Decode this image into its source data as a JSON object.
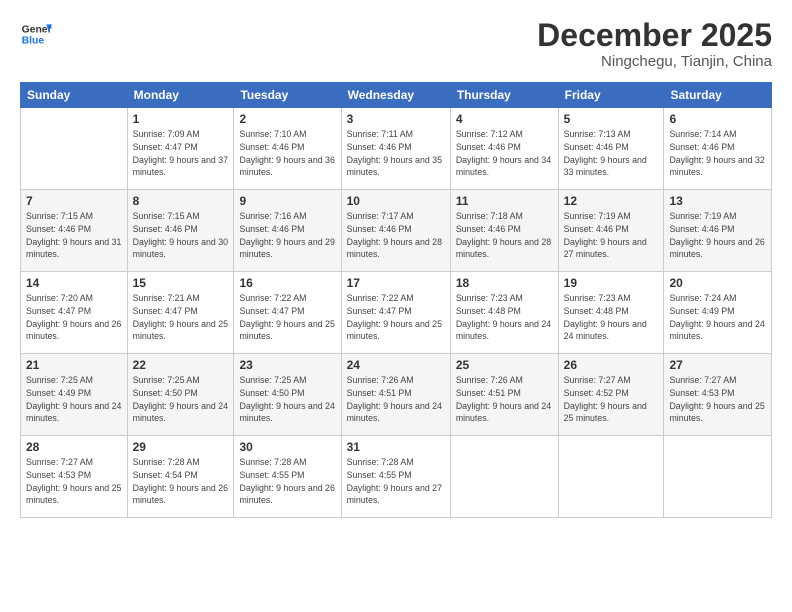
{
  "logo": {
    "line1": "General",
    "line2": "Blue"
  },
  "title": "December 2025",
  "location": "Ningchegu, Tianjin, China",
  "weekdays": [
    "Sunday",
    "Monday",
    "Tuesday",
    "Wednesday",
    "Thursday",
    "Friday",
    "Saturday"
  ],
  "weeks": [
    [
      {
        "day": "",
        "sunrise": "",
        "sunset": "",
        "daylight": ""
      },
      {
        "day": "1",
        "sunrise": "Sunrise: 7:09 AM",
        "sunset": "Sunset: 4:47 PM",
        "daylight": "Daylight: 9 hours and 37 minutes."
      },
      {
        "day": "2",
        "sunrise": "Sunrise: 7:10 AM",
        "sunset": "Sunset: 4:46 PM",
        "daylight": "Daylight: 9 hours and 36 minutes."
      },
      {
        "day": "3",
        "sunrise": "Sunrise: 7:11 AM",
        "sunset": "Sunset: 4:46 PM",
        "daylight": "Daylight: 9 hours and 35 minutes."
      },
      {
        "day": "4",
        "sunrise": "Sunrise: 7:12 AM",
        "sunset": "Sunset: 4:46 PM",
        "daylight": "Daylight: 9 hours and 34 minutes."
      },
      {
        "day": "5",
        "sunrise": "Sunrise: 7:13 AM",
        "sunset": "Sunset: 4:46 PM",
        "daylight": "Daylight: 9 hours and 33 minutes."
      },
      {
        "day": "6",
        "sunrise": "Sunrise: 7:14 AM",
        "sunset": "Sunset: 4:46 PM",
        "daylight": "Daylight: 9 hours and 32 minutes."
      }
    ],
    [
      {
        "day": "7",
        "sunrise": "Sunrise: 7:15 AM",
        "sunset": "Sunset: 4:46 PM",
        "daylight": "Daylight: 9 hours and 31 minutes."
      },
      {
        "day": "8",
        "sunrise": "Sunrise: 7:15 AM",
        "sunset": "Sunset: 4:46 PM",
        "daylight": "Daylight: 9 hours and 30 minutes."
      },
      {
        "day": "9",
        "sunrise": "Sunrise: 7:16 AM",
        "sunset": "Sunset: 4:46 PM",
        "daylight": "Daylight: 9 hours and 29 minutes."
      },
      {
        "day": "10",
        "sunrise": "Sunrise: 7:17 AM",
        "sunset": "Sunset: 4:46 PM",
        "daylight": "Daylight: 9 hours and 28 minutes."
      },
      {
        "day": "11",
        "sunrise": "Sunrise: 7:18 AM",
        "sunset": "Sunset: 4:46 PM",
        "daylight": "Daylight: 9 hours and 28 minutes."
      },
      {
        "day": "12",
        "sunrise": "Sunrise: 7:19 AM",
        "sunset": "Sunset: 4:46 PM",
        "daylight": "Daylight: 9 hours and 27 minutes."
      },
      {
        "day": "13",
        "sunrise": "Sunrise: 7:19 AM",
        "sunset": "Sunset: 4:46 PM",
        "daylight": "Daylight: 9 hours and 26 minutes."
      }
    ],
    [
      {
        "day": "14",
        "sunrise": "Sunrise: 7:20 AM",
        "sunset": "Sunset: 4:47 PM",
        "daylight": "Daylight: 9 hours and 26 minutes."
      },
      {
        "day": "15",
        "sunrise": "Sunrise: 7:21 AM",
        "sunset": "Sunset: 4:47 PM",
        "daylight": "Daylight: 9 hours and 25 minutes."
      },
      {
        "day": "16",
        "sunrise": "Sunrise: 7:22 AM",
        "sunset": "Sunset: 4:47 PM",
        "daylight": "Daylight: 9 hours and 25 minutes."
      },
      {
        "day": "17",
        "sunrise": "Sunrise: 7:22 AM",
        "sunset": "Sunset: 4:47 PM",
        "daylight": "Daylight: 9 hours and 25 minutes."
      },
      {
        "day": "18",
        "sunrise": "Sunrise: 7:23 AM",
        "sunset": "Sunset: 4:48 PM",
        "daylight": "Daylight: 9 hours and 24 minutes."
      },
      {
        "day": "19",
        "sunrise": "Sunrise: 7:23 AM",
        "sunset": "Sunset: 4:48 PM",
        "daylight": "Daylight: 9 hours and 24 minutes."
      },
      {
        "day": "20",
        "sunrise": "Sunrise: 7:24 AM",
        "sunset": "Sunset: 4:49 PM",
        "daylight": "Daylight: 9 hours and 24 minutes."
      }
    ],
    [
      {
        "day": "21",
        "sunrise": "Sunrise: 7:25 AM",
        "sunset": "Sunset: 4:49 PM",
        "daylight": "Daylight: 9 hours and 24 minutes."
      },
      {
        "day": "22",
        "sunrise": "Sunrise: 7:25 AM",
        "sunset": "Sunset: 4:50 PM",
        "daylight": "Daylight: 9 hours and 24 minutes."
      },
      {
        "day": "23",
        "sunrise": "Sunrise: 7:25 AM",
        "sunset": "Sunset: 4:50 PM",
        "daylight": "Daylight: 9 hours and 24 minutes."
      },
      {
        "day": "24",
        "sunrise": "Sunrise: 7:26 AM",
        "sunset": "Sunset: 4:51 PM",
        "daylight": "Daylight: 9 hours and 24 minutes."
      },
      {
        "day": "25",
        "sunrise": "Sunrise: 7:26 AM",
        "sunset": "Sunset: 4:51 PM",
        "daylight": "Daylight: 9 hours and 24 minutes."
      },
      {
        "day": "26",
        "sunrise": "Sunrise: 7:27 AM",
        "sunset": "Sunset: 4:52 PM",
        "daylight": "Daylight: 9 hours and 25 minutes."
      },
      {
        "day": "27",
        "sunrise": "Sunrise: 7:27 AM",
        "sunset": "Sunset: 4:53 PM",
        "daylight": "Daylight: 9 hours and 25 minutes."
      }
    ],
    [
      {
        "day": "28",
        "sunrise": "Sunrise: 7:27 AM",
        "sunset": "Sunset: 4:53 PM",
        "daylight": "Daylight: 9 hours and 25 minutes."
      },
      {
        "day": "29",
        "sunrise": "Sunrise: 7:28 AM",
        "sunset": "Sunset: 4:54 PM",
        "daylight": "Daylight: 9 hours and 26 minutes."
      },
      {
        "day": "30",
        "sunrise": "Sunrise: 7:28 AM",
        "sunset": "Sunset: 4:55 PM",
        "daylight": "Daylight: 9 hours and 26 minutes."
      },
      {
        "day": "31",
        "sunrise": "Sunrise: 7:28 AM",
        "sunset": "Sunset: 4:55 PM",
        "daylight": "Daylight: 9 hours and 27 minutes."
      },
      {
        "day": "",
        "sunrise": "",
        "sunset": "",
        "daylight": ""
      },
      {
        "day": "",
        "sunrise": "",
        "sunset": "",
        "daylight": ""
      },
      {
        "day": "",
        "sunrise": "",
        "sunset": "",
        "daylight": ""
      }
    ]
  ]
}
